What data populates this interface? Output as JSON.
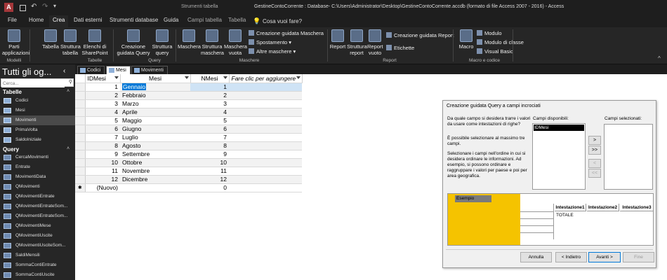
{
  "title": {
    "context_tools": "Strumenti tabella",
    "window_title": "GestineContoCorrente : Database- C:\\Users\\Administrator\\Desktop\\GestineContoCorrente.accdb (formato di file Access 2007 - 2016) - Access"
  },
  "tabs": [
    "File",
    "Home",
    "Crea",
    "Dati esterni",
    "Strumenti database",
    "Guida",
    "Campi tabella",
    "Tabella"
  ],
  "tell_me": "Cosa vuoi fare?",
  "ribbon": {
    "parti": "Parti applicazioni",
    "tabella": "Tabella",
    "struttura_tabella": "Struttura tabella",
    "elenchi": "Elenchi di SharePoint",
    "creazione_query": "Creazione guidata Query",
    "struttura_query": "Struttura query",
    "maschera": "Maschera",
    "struttura_maschera": "Struttura maschera",
    "maschera_vuota": "Maschera vuota",
    "creazione_maschera": "Creazione guidata Maschera",
    "spostamento": "Spostamento",
    "altre_maschere": "Altre maschere",
    "report": "Report",
    "struttura_report": "Struttura report",
    "report_vuoto": "Report vuoto",
    "creazione_report": "Creazione guidata Report",
    "etichette": "Etichette",
    "macro": "Macro",
    "modulo": "Modulo",
    "modulo_classe": "Modulo di classe",
    "visual_basic": "Visual Basic",
    "groups": [
      "Modelli",
      "Tabelle",
      "Query",
      "Maschere",
      "Report",
      "Macro e codice"
    ]
  },
  "nav": {
    "title": "Tutti gli og...",
    "search_placeholder": "Cerca...",
    "tables_header": "Tabelle",
    "tables": [
      "Codici",
      "Mesi",
      "Movimenti",
      "PrimaVolta",
      "SaldoIniziale"
    ],
    "query_header": "Query",
    "queries": [
      "CercaMovimenti",
      "Entrate",
      "MovimentiData",
      "QMovimenti",
      "QMovimentiEntrate",
      "QMovimentiEntrateSom...",
      "QMovimentiEntrateSom...",
      "QMovimentiMese",
      "QMovimentiUscite",
      "QMovimentiUsciteSom...",
      "SaldiMensili",
      "SommaContiEntrate",
      "SommaContiUscite"
    ]
  },
  "doc_tabs": [
    "Codici",
    "Mesi",
    "Movimenti"
  ],
  "grid": {
    "headers": [
      "IDMesi",
      "Mesi",
      "NMesi",
      "Fare clic per aggiungere"
    ],
    "rows": [
      [
        "1",
        "Gennaio",
        "1"
      ],
      [
        "2",
        "Febbraio",
        "2"
      ],
      [
        "3",
        "Marzo",
        "3"
      ],
      [
        "4",
        "Aprile",
        "4"
      ],
      [
        "5",
        "Maggio",
        "5"
      ],
      [
        "6",
        "Giugno",
        "6"
      ],
      [
        "7",
        "Luglio",
        "7"
      ],
      [
        "8",
        "Agosto",
        "8"
      ],
      [
        "9",
        "Settembre",
        "9"
      ],
      [
        "10",
        "Ottobre",
        "10"
      ],
      [
        "11",
        "Novembre",
        "11"
      ],
      [
        "12",
        "Dicembre",
        "12"
      ]
    ],
    "new_row": [
      "(Nuovo)",
      "",
      "0"
    ]
  },
  "wizard": {
    "title": "Creazione guidata Query a campi incrociati",
    "q1": "Da quale campo si desidera trarre i valori da usare come intestazioni di righe?",
    "q2": "È possibile selezionare al massimo tre campi.",
    "q3": "Selezionare i campi nell'ordine in cui si desidera ordinare le informazioni. Ad esempio, si possono ordinare e raggruppare i valori per paese e poi per area geografica.",
    "available_label": "Campi disponibili:",
    "selected_label": "Campi selezionati:",
    "available": [
      "IDMesi"
    ],
    "sample_label": "Esempio",
    "headers": [
      "Intestazione1",
      "Intestazione2",
      "Intestazione3"
    ],
    "totale": "TOTALE",
    "btn_add": ">",
    "btn_add_all": ">>",
    "btn_remove": "<",
    "btn_remove_all": "<<",
    "cancel": "Annulla",
    "back": "< Indietro",
    "next": "Avanti >",
    "finish": "Fine"
  }
}
